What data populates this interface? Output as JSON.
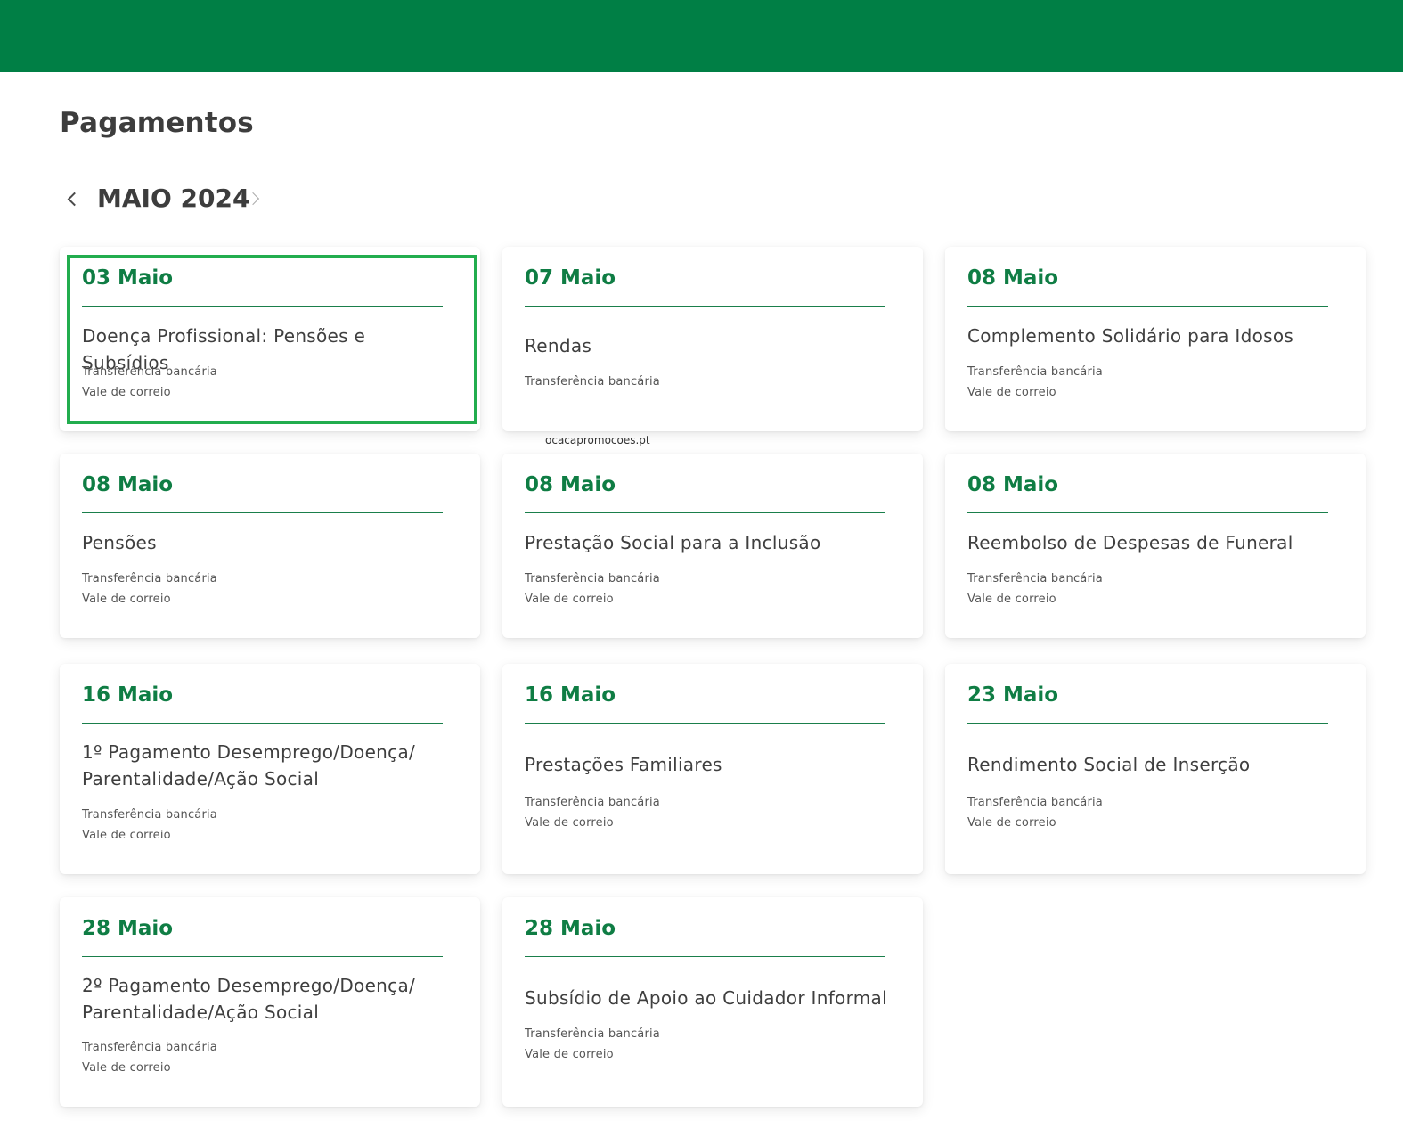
{
  "header": {
    "brand_color": "#007f45"
  },
  "page": {
    "title": "Pagamentos"
  },
  "calendar": {
    "month_label": "MAIO 2024",
    "prev_icon": "chevron-left-icon",
    "next_icon": "chevron-right-icon"
  },
  "watermark": "ocacapromocoes.pt",
  "cards": [
    {
      "date": "03 Maio",
      "title": "Doença Profissional: Pensões e Subsídios",
      "methods": [
        "Transferência bancária",
        "Vale de correio"
      ],
      "selected": true
    },
    {
      "date": "07 Maio",
      "title": "Rendas",
      "methods": [
        "Transferência bancária"
      ]
    },
    {
      "date": "08 Maio",
      "title": "Complemento Solidário para Idosos",
      "methods": [
        "Transferência bancária",
        "Vale de correio"
      ]
    },
    {
      "date": "08 Maio",
      "title": "Pensões",
      "methods": [
        "Transferência bancária",
        "Vale de correio"
      ]
    },
    {
      "date": "08 Maio",
      "title": "Prestação Social para a Inclusão",
      "methods": [
        "Transferência bancária",
        "Vale de correio"
      ]
    },
    {
      "date": "08 Maio",
      "title": "Reembolso de Despesas de Funeral",
      "methods": [
        "Transferência bancária",
        "Vale de correio"
      ]
    },
    {
      "date": "16 Maio",
      "title": "1º Pagamento Desemprego/Doença/ Parentalidade/Ação Social",
      "methods": [
        "Transferência bancária",
        "Vale de correio"
      ]
    },
    {
      "date": "16 Maio",
      "title": "Prestações Familiares",
      "methods": [
        "Transferência bancária",
        "Vale de correio"
      ]
    },
    {
      "date": "23 Maio",
      "title": "Rendimento Social de Inserção",
      "methods": [
        "Transferência bancária",
        "Vale de correio"
      ]
    },
    {
      "date": "28 Maio",
      "title": "2º Pagamento Desemprego/Doença/ Parentalidade/Ação Social",
      "methods": [
        "Transferência bancária",
        "Vale de correio"
      ]
    },
    {
      "date": "28 Maio",
      "title": "Subsídio de Apoio ao Cuidador Informal",
      "methods": [
        "Transferência bancária",
        "Vale de correio"
      ]
    }
  ]
}
